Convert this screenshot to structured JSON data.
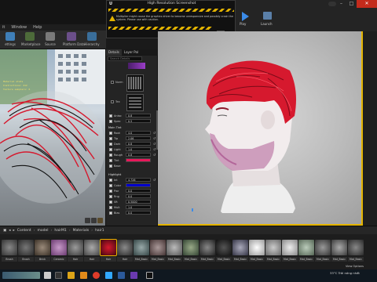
{
  "menu": [
    "it",
    "Window",
    "Help"
  ],
  "toolbar": [
    {
      "label": "ettings",
      "color": "#3f7fb8"
    },
    {
      "label": "Marketplace",
      "color": "#4d6b3a"
    },
    {
      "label": "Source",
      "color": "#7a7a7a"
    },
    {
      "label": "Platform Data",
      "color": "#6b4f8a"
    },
    {
      "label": "Hierarchy",
      "color": "#3a6e9a"
    }
  ],
  "dialog": {
    "title": "High Resolution Screenshot",
    "warning": "Multiplier might cause the graphics driver to become unresponsive and possibly crash the system. Please use with caution."
  },
  "play": {
    "play_label": "Play",
    "launch_label": "Launch"
  },
  "details": {
    "tabs": [
      "Details",
      "Layer Pal"
    ],
    "search_placeholder": "Search Details",
    "textures": [
      {
        "name": "Norm"
      },
      {
        "name": "Tex"
      }
    ],
    "params": [
      {
        "name": "Aniso",
        "value": "0.8"
      },
      {
        "name": "Spec",
        "value": "0.5"
      }
    ],
    "group_main": "Main Tint",
    "main_params": [
      {
        "name": "Root",
        "value": "4.0"
      },
      {
        "name": "Tip",
        "value": "2.06"
      },
      {
        "name": "Dark",
        "value": "0.8"
      },
      {
        "name": "Light",
        "value": "1.0"
      },
      {
        "name": "Rough",
        "value": "0.8"
      },
      {
        "name": "Tint"
      },
      {
        "name": "Base"
      }
    ],
    "group_highlight": "Highlight",
    "hl_params": [
      {
        "name": "Int",
        "value": "4.726"
      },
      {
        "name": "Color"
      },
      {
        "name": "Pwr",
        "value": "0.0"
      },
      {
        "name": "Rng",
        "value": "0.0"
      },
      {
        "name": "Sft",
        "value": "0.5000"
      },
      {
        "name": "Mult",
        "value": "1.0"
      },
      {
        "name": "Bias",
        "value": "0.0"
      }
    ]
  },
  "swatches": {
    "tint": "#e8185a",
    "highlight": "#0000cc",
    "hair_red": "#d6192e"
  },
  "breadcrumb": [
    "Content",
    "model",
    "hairM1",
    "Materials",
    "hair1"
  ],
  "assets": [
    "Brush",
    "Brush",
    "Brick",
    "Ceramic",
    "Hair",
    "Hair",
    "Hair",
    "Hair",
    "Mat_Basic",
    "Mat_Basic",
    "Mat_Basic",
    "Mat_Basic",
    "Mat_Basic",
    "Mat_Basic",
    "Mat_Basic",
    "Mat_Basic",
    "Mat_Basic",
    "Mat_Basic",
    "Mat_Basic",
    "Mat_Basic",
    "Mat_Basic",
    "Mat_Basic"
  ],
  "view_options": "View Options",
  "tray": {
    "temp": "33°C",
    "status": "Trời nóng nhất"
  }
}
